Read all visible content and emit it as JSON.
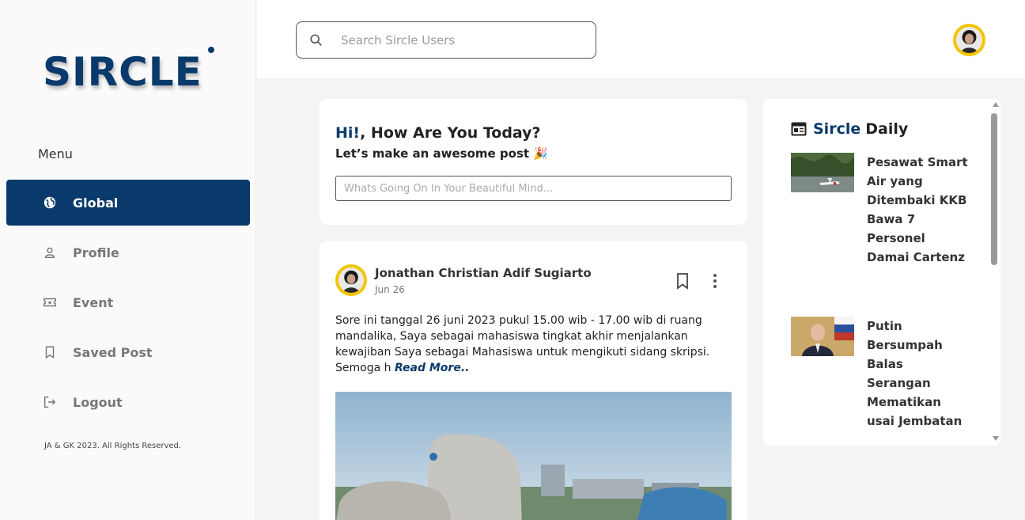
{
  "app": {
    "logo": "SIRCLE"
  },
  "sidebar": {
    "menu_title": "Menu",
    "items": [
      {
        "label": "Global",
        "icon": "globe-icon",
        "active": true
      },
      {
        "label": "Profile",
        "icon": "user-icon",
        "active": false
      },
      {
        "label": "Event",
        "icon": "ticket-icon",
        "active": false
      },
      {
        "label": "Saved Post",
        "icon": "bookmark-icon",
        "active": false
      },
      {
        "label": "Logout",
        "icon": "logout-icon",
        "active": false
      }
    ],
    "copyright": "JA & GK 2023. All Rights Reserved."
  },
  "header": {
    "search_placeholder": "Search Sircle Users"
  },
  "composer": {
    "hi": "Hi!",
    "greeting": ", How Are You Today?",
    "subtitle": "Let’s make an awesome post 🎉",
    "placeholder": "Whats Going On In Your Beautiful Mind..."
  },
  "post": {
    "author": "Jonathan Christian Adif Sugiarto",
    "date": "Jun 26",
    "text": "Sore ini tanggal 26 juni 2023 pukul 15.00 wib - 17.00 wib di ruang mandalika, Saya sebagai mahasiswa tingkat akhir menjalankan kewajiban Saya sebagai Mahasiswa untuk mengikuti sidang skripsi. Semoga h ",
    "read_more": "Read More.."
  },
  "news": {
    "brand": "Sircle",
    "title": "Daily",
    "items": [
      {
        "headline": "Pesawat Smart Air yang Ditembaki KKB Bawa 7 Personel Damai Cartenz"
      },
      {
        "headline": "Putin Bersumpah Balas Serangan Mematikan usai Jembatan"
      }
    ]
  },
  "colors": {
    "brand": "#0a3a6b",
    "avatar_ring": "#f5c400"
  }
}
